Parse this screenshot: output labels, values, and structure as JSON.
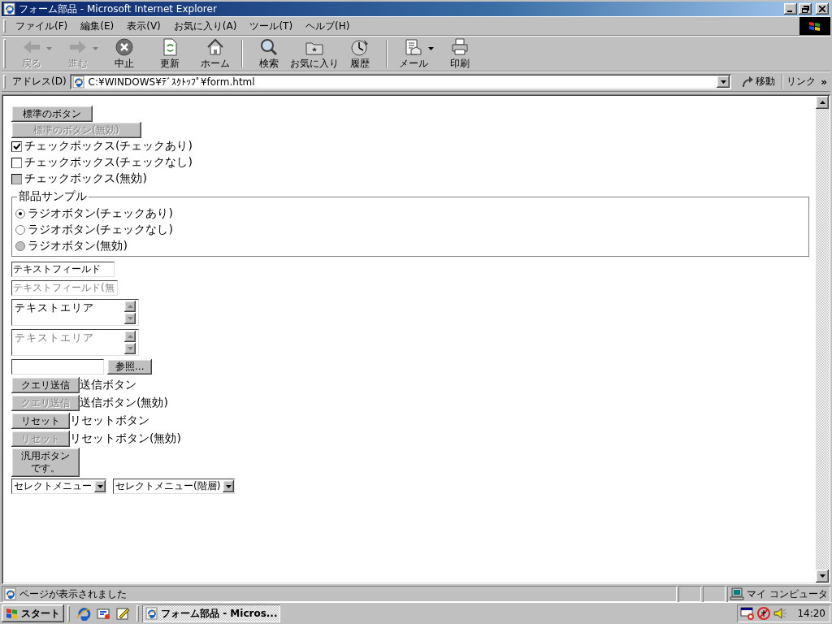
{
  "window": {
    "title": "フォーム部品 - Microsoft Internet Explorer"
  },
  "menu": [
    {
      "label": "ファイル(F)"
    },
    {
      "label": "編集(E)"
    },
    {
      "label": "表示(V)"
    },
    {
      "label": "お気に入り(A)"
    },
    {
      "label": "ツール(T)"
    },
    {
      "label": "ヘルプ(H)"
    }
  ],
  "toolbar": {
    "groups": [
      [
        {
          "kind": "back",
          "label": "戻る",
          "disabled": true,
          "dropdown": true
        },
        {
          "kind": "forward",
          "label": "進む",
          "disabled": true,
          "dropdown": true
        },
        {
          "kind": "stop",
          "label": "中止",
          "disabled": false,
          "dropdown": false
        },
        {
          "kind": "refresh",
          "label": "更新",
          "disabled": false,
          "dropdown": false
        },
        {
          "kind": "home",
          "label": "ホーム",
          "disabled": false,
          "dropdown": false
        }
      ],
      [
        {
          "kind": "search",
          "label": "検索",
          "disabled": false,
          "dropdown": false
        },
        {
          "kind": "favorites",
          "label": "お気に入り",
          "disabled": false,
          "dropdown": false
        },
        {
          "kind": "history",
          "label": "履歴",
          "disabled": false,
          "dropdown": false
        }
      ],
      [
        {
          "kind": "mail",
          "label": "メール",
          "disabled": false,
          "dropdown": true
        },
        {
          "kind": "print",
          "label": "印刷",
          "disabled": false,
          "dropdown": false
        }
      ]
    ]
  },
  "address": {
    "label": "アドレス(D)",
    "value": "C:¥WINDOWS¥ﾃﾞｽｸﾄｯﾌﾟ¥form.html",
    "go": "移動",
    "links": "リンク",
    "more": "»"
  },
  "form": {
    "items": [
      {
        "kind": "button",
        "label": "標準のボタン",
        "disabled": false
      },
      {
        "kind": "button",
        "label": "標準のボタン(無効)",
        "disabled": true
      },
      {
        "kind": "checkbox",
        "label": "チェックボックス(チェックあり)",
        "checked": true,
        "disabled": false
      },
      {
        "kind": "checkbox",
        "label": "チェックボックス(チェックなし)",
        "checked": false,
        "disabled": false
      },
      {
        "kind": "checkbox",
        "label": "チェックボックス(無効)",
        "checked": false,
        "disabled": true
      },
      {
        "kind": "fieldset",
        "legend": "部品サンプル",
        "radios": [
          {
            "label": "ラジオボタン(チェックあり)",
            "selected": true,
            "disabled": false
          },
          {
            "label": "ラジオボタン(チェックなし)",
            "selected": false,
            "disabled": false
          },
          {
            "label": "ラジオボタン(無効)",
            "selected": false,
            "disabled": true
          }
        ]
      },
      {
        "kind": "text",
        "value": "テキストフィールド",
        "disabled": false
      },
      {
        "kind": "text",
        "value": "テキストフィールド(無",
        "disabled": true
      },
      {
        "kind": "textarea",
        "value": "テキストエリア",
        "disabled": false
      },
      {
        "kind": "textarea",
        "value": "テキストエリア",
        "disabled": true
      },
      {
        "kind": "file",
        "button": "参照..."
      },
      {
        "kind": "submit",
        "button": "クエリ送信",
        "label": "送信ボタン",
        "disabled": false
      },
      {
        "kind": "submit",
        "button": "クエリ送信",
        "label": "送信ボタン(無効)",
        "disabled": true
      },
      {
        "kind": "reset",
        "button": "リセット",
        "label": "リセットボタン",
        "disabled": false
      },
      {
        "kind": "reset",
        "button": "リセット",
        "label": "リセットボタン(無効)",
        "disabled": true
      },
      {
        "kind": "button",
        "label": "汎用ボタンです。",
        "disabled": false
      },
      {
        "kind": "selects",
        "selects": [
          {
            "value": "セレクトメニュー"
          },
          {
            "value": "セレクトメニュー(階層)"
          }
        ]
      }
    ]
  },
  "status_bar": {
    "text": "ページが表示されました",
    "zone": "マイ コンピュータ"
  },
  "taskbar": {
    "start": "スタート",
    "tasks": [
      {
        "label": "フォーム部品 - Micros...",
        "selected": true
      }
    ],
    "clock": "14:20"
  }
}
